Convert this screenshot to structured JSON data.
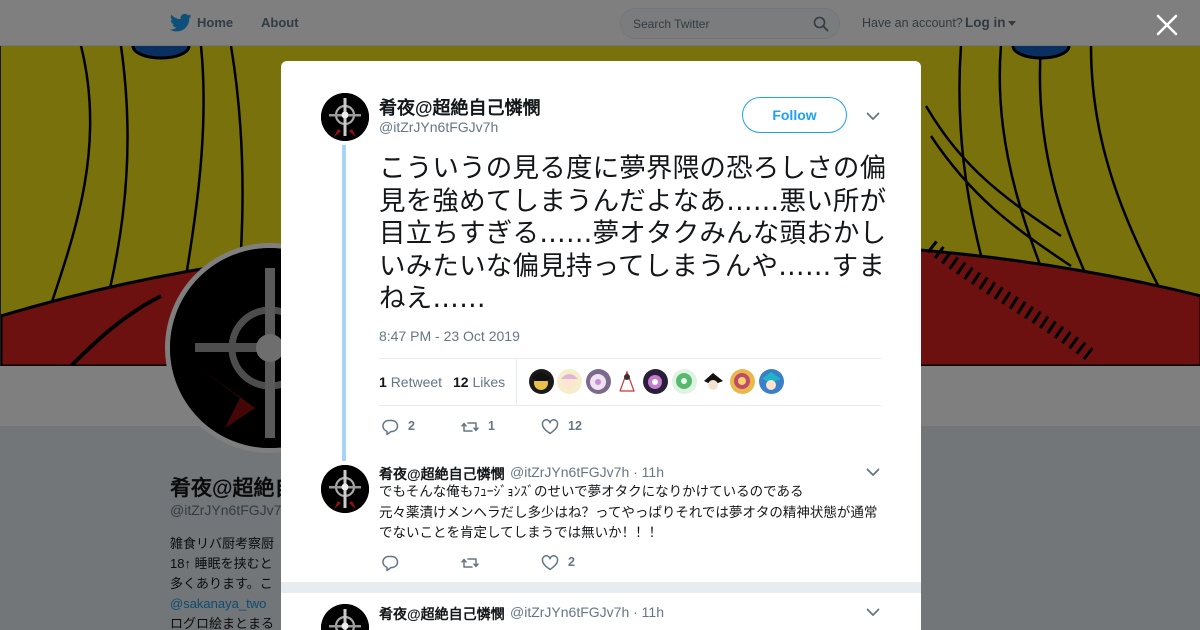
{
  "topbar": {
    "home_label": "Home",
    "about_label": "About",
    "search_placeholder": "Search Twitter",
    "have_account": "Have an account?",
    "login_label": "Log in"
  },
  "profile": {
    "name": "肴夜@超絶自",
    "handle": "@itZrJYn6tFGJv7",
    "bio_lines": [
      "雑食リバ厨考察厨",
      "18↑ 睡眠を挟むと",
      "多くあります。こ"
    ],
    "bio_link": "@sakanaya_two",
    "bio_tail": "ログロ絵まとまる"
  },
  "tweet": {
    "author_name": "肴夜@超絶自己憐憫",
    "author_handle": "@itZrJYn6tFGJv7h",
    "follow_label": "Follow",
    "text": "こういうの見る度に夢界隈の恐ろしさの偏見を強めてしまうんだよなあ……悪い所が目立ちすぎる……夢オタクみんな頭おかしいみたいな偏見持ってしまうんや……すまねえ……",
    "timestamp": "8:47 PM - 23 Oct 2019",
    "retweet_count": "1",
    "retweet_label": "Retweet",
    "like_count": "12",
    "like_label": "Likes",
    "actions": {
      "replies": "2",
      "retweets": "1",
      "likes": "12"
    }
  },
  "replies": [
    {
      "name": "肴夜@超絶自己憐憫",
      "meta": "@itZrJYn6tFGJv7h · 11h",
      "text": "でもそんな俺もﾌｭｰｼﾞｮﾝｽﾞのせいで夢オタクになりかけているのである\n元々薬漬けメンヘラだし多少はね？ってやっぱりそれでは夢オタの精神状態が通常でないことを肯定してしまうでは無いか！！！",
      "actions": {
        "replies": "",
        "retweets": "",
        "likes": "2"
      }
    },
    {
      "name": "肴夜@超絶自己憐憫",
      "meta": "@itZrJYn6tFGJv7h · 11h",
      "text": ""
    }
  ],
  "colors": {
    "accent": "#1da1f2",
    "thread_line": "#a6d4f2",
    "banner": "#f1e218",
    "muted": "#657786"
  }
}
